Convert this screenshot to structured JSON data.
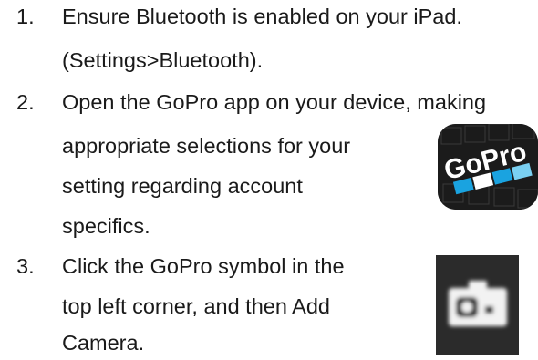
{
  "steps": [
    {
      "number": "1.",
      "lines": [
        "Ensure Bluetooth is enabled on your iPad.",
        "(Settings>Bluetooth)."
      ]
    },
    {
      "number": "2.",
      "lines": [
        "Open the GoPro app on your device, making",
        "appropriate selections for your",
        "setting regarding account",
        "specifics."
      ],
      "image": "gopro-app-icon"
    },
    {
      "number": "3.",
      "lines": [
        "Click the GoPro symbol in the",
        "top left corner, and then Add",
        "Camera."
      ],
      "image": "camera-symbol-icon"
    }
  ],
  "icon_text": {
    "app_logo": "GoPro"
  },
  "colors": {
    "text": "#1a1a1a",
    "gopro_blue": "#1aa3e0",
    "icon_dark": "#1b1b1b"
  }
}
